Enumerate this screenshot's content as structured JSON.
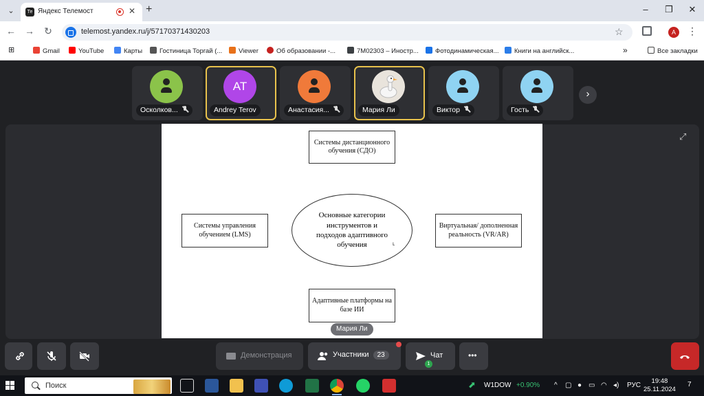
{
  "browser": {
    "tab_title": "Яндекс Телемост",
    "tab_favicon": "Те",
    "new_tab": "+",
    "url": "telemost.yandex.ru/j/57170371430203",
    "profile_initial": "А",
    "bookmarks": [
      {
        "label": "Gmail",
        "color": "#ea4335"
      },
      {
        "label": "YouTube",
        "color": "#ff0000"
      },
      {
        "label": "Карты",
        "color": "#4285f4"
      },
      {
        "label": "Гостиница Торгай (...",
        "color": "#555555"
      },
      {
        "label": "Viewer",
        "color": "#e8711a"
      },
      {
        "label": "Об образовании -...",
        "color": "#c5221f"
      },
      {
        "label": "7M02303 – Иностр...",
        "color": "#3c4043"
      },
      {
        "label": "Фотодинамическая...",
        "color": "#1a73e8"
      },
      {
        "label": "Книги на английск...",
        "color": "#2b7de9"
      }
    ],
    "bookmarks_overflow": "»",
    "all_bookmarks": "Все закладки"
  },
  "participants": [
    {
      "name": "Осколков...",
      "initials": "",
      "color": "#8bc34a",
      "muted": true,
      "speaking": false
    },
    {
      "name": "Andrey Terov",
      "initials": "AT",
      "color": "#b046e8",
      "muted": false,
      "speaking": true
    },
    {
      "name": "Анастасия...",
      "initials": "",
      "color": "#f07a3a",
      "muted": true,
      "speaking": false
    },
    {
      "name": "Мария Ли",
      "initials": "",
      "color": "#e9e4dc",
      "muted": false,
      "speaking": true
    },
    {
      "name": "Виктор",
      "initials": "",
      "color": "#8fd3f2",
      "muted": true,
      "speaking": false
    },
    {
      "name": "Гость",
      "initials": "",
      "color": "#8fd3f2",
      "muted": true,
      "speaking": false
    }
  ],
  "slide": {
    "center": "Основные категории инструментов и подходов адаптивного обучения",
    "top": "Системы дистанционного обучения (СДО)",
    "left": "Системы управления обучением (LMS)",
    "right": "Виртуальная/ дополненная реальность (VR/AR)",
    "bottom": "Адаптивные платформы на базе ИИ",
    "cursor": "ʟ"
  },
  "presenter": "Мария Ли",
  "controls": {
    "demo_label": "Демонстрация",
    "participants_label": "Участники",
    "participants_count": "23",
    "chat_label": "Чат",
    "chat_unread": "1",
    "more": "•••"
  },
  "taskbar": {
    "search_placeholder": "Поиск",
    "ticker": "W1DOW",
    "ticker_change": "+0.90%",
    "lang": "РУС",
    "time": "19:48",
    "date": "25.11.2024",
    "notifications": "7"
  }
}
